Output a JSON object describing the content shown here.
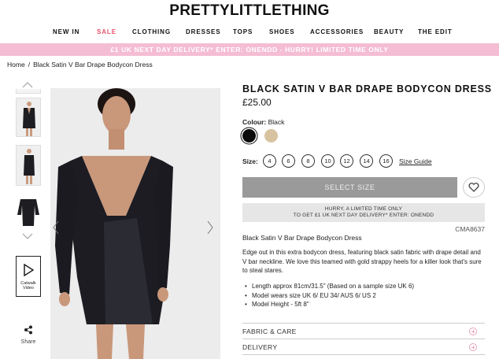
{
  "brand": "PRETTYLITTLETHING",
  "nav": {
    "items": [
      "NEW IN",
      "SALE",
      "CLOTHING",
      "DRESSES",
      "TOPS",
      "SHOES",
      "ACCESSORIES",
      "BEAUTY",
      "THE EDIT"
    ],
    "highlight_color": "#e8526a"
  },
  "promo": {
    "text": "£1 UK NEXT DAY DELIVERY* ENTER: ONENDD - HURRY! LIMITED TIME ONLY",
    "background": "#f4bdd3"
  },
  "breadcrumb": {
    "home": "Home",
    "separator": "/",
    "current": "Black Satin V Bar Drape Bodycon Dress"
  },
  "gallery": {
    "video_label_line1": "Catwalk",
    "video_label_line2": "Video",
    "share_label": "Share"
  },
  "product": {
    "title": "BLACK SATIN V BAR DRAPE BODYCON DRESS",
    "price": "£25.00",
    "colour_label": "Colour:",
    "colour_value": "Black",
    "swatches": [
      "#0b0b0b",
      "#d8c3a1"
    ],
    "size_label": "Size:",
    "sizes": [
      "4",
      "6",
      "8",
      "10",
      "12",
      "14",
      "16"
    ],
    "size_guide": "Size Guide",
    "select_button": "SELECT SIZE",
    "hurry_line1": "HURRY, A LIMITED TIME ONLY",
    "hurry_line2": "TO GET £1 UK NEXT DAY DELIVERY* ENTER: ONENDD",
    "sku": "CMA8637",
    "desc_title": "Black Satin V Bar Drape Bodycon Dress",
    "description": "Edge out in this extra bodycon dress, featuring black satin fabric with drape detail and V bar neckline. We love this teamed with gold strappy heels for a killer look that's sure to steal stares.",
    "bullets": [
      "Length approx 81cm/31.5\" (Based on a sample size UK 6)",
      "Model wears size UK 6/ EU 34/ AUS 6/ US 2",
      "Model Height - 5ft 8\""
    ],
    "accordions": [
      "FABRIC & CARE",
      "DELIVERY"
    ]
  }
}
